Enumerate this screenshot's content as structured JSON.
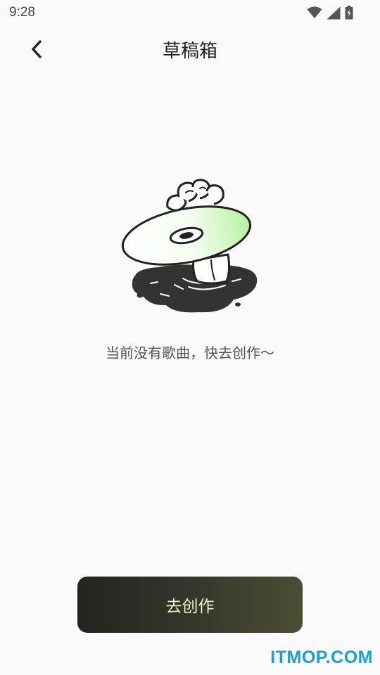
{
  "status_bar": {
    "time": "9:28",
    "icons": [
      "wifi-icon",
      "signal-icon",
      "battery-icon"
    ]
  },
  "header": {
    "back_icon": "chevron-left-icon",
    "title": "草稿箱"
  },
  "empty_state": {
    "illustration": "disc-in-puddle-illustration",
    "message": "当前没有歌曲，快去创作～"
  },
  "actions": {
    "create_label": "去创作"
  },
  "watermark": "ITMOP.COM",
  "colors": {
    "background": "#fafafa",
    "button_gradient_start": "#23241f",
    "button_gradient_end": "#4c4e33",
    "button_text": "#e9f5c2",
    "accent_green": "#b9f5a8",
    "watermark": "#1a9ddb"
  }
}
